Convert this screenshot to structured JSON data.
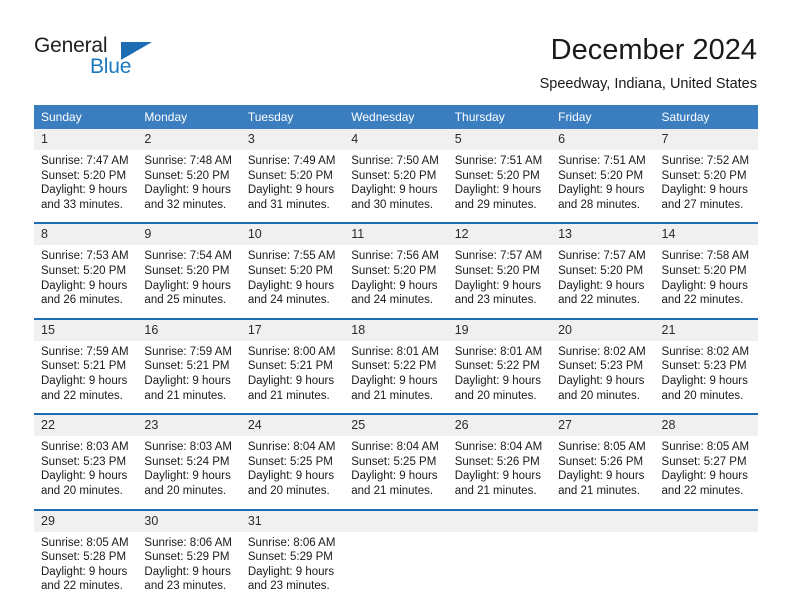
{
  "brand": {
    "name_part1": "General",
    "name_part2": "Blue",
    "logo_icon": "triangle-flag-icon",
    "accent_color": "#1c6cb3"
  },
  "header": {
    "title": "December 2024",
    "subtitle": "Speedway, Indiana, United States"
  },
  "theme": {
    "header_blue": "#3a7ebf",
    "separator_blue": "#1c6cb3",
    "daynum_band": "#f0f0f0"
  },
  "weekday_headers": [
    "Sunday",
    "Monday",
    "Tuesday",
    "Wednesday",
    "Thursday",
    "Friday",
    "Saturday"
  ],
  "weeks": [
    [
      {
        "day": "1",
        "sunrise": "Sunrise: 7:47 AM",
        "sunset": "Sunset: 5:20 PM",
        "daylight_1": "Daylight: 9 hours",
        "daylight_2": "and 33 minutes."
      },
      {
        "day": "2",
        "sunrise": "Sunrise: 7:48 AM",
        "sunset": "Sunset: 5:20 PM",
        "daylight_1": "Daylight: 9 hours",
        "daylight_2": "and 32 minutes."
      },
      {
        "day": "3",
        "sunrise": "Sunrise: 7:49 AM",
        "sunset": "Sunset: 5:20 PM",
        "daylight_1": "Daylight: 9 hours",
        "daylight_2": "and 31 minutes."
      },
      {
        "day": "4",
        "sunrise": "Sunrise: 7:50 AM",
        "sunset": "Sunset: 5:20 PM",
        "daylight_1": "Daylight: 9 hours",
        "daylight_2": "and 30 minutes."
      },
      {
        "day": "5",
        "sunrise": "Sunrise: 7:51 AM",
        "sunset": "Sunset: 5:20 PM",
        "daylight_1": "Daylight: 9 hours",
        "daylight_2": "and 29 minutes."
      },
      {
        "day": "6",
        "sunrise": "Sunrise: 7:51 AM",
        "sunset": "Sunset: 5:20 PM",
        "daylight_1": "Daylight: 9 hours",
        "daylight_2": "and 28 minutes."
      },
      {
        "day": "7",
        "sunrise": "Sunrise: 7:52 AM",
        "sunset": "Sunset: 5:20 PM",
        "daylight_1": "Daylight: 9 hours",
        "daylight_2": "and 27 minutes."
      }
    ],
    [
      {
        "day": "8",
        "sunrise": "Sunrise: 7:53 AM",
        "sunset": "Sunset: 5:20 PM",
        "daylight_1": "Daylight: 9 hours",
        "daylight_2": "and 26 minutes."
      },
      {
        "day": "9",
        "sunrise": "Sunrise: 7:54 AM",
        "sunset": "Sunset: 5:20 PM",
        "daylight_1": "Daylight: 9 hours",
        "daylight_2": "and 25 minutes."
      },
      {
        "day": "10",
        "sunrise": "Sunrise: 7:55 AM",
        "sunset": "Sunset: 5:20 PM",
        "daylight_1": "Daylight: 9 hours",
        "daylight_2": "and 24 minutes."
      },
      {
        "day": "11",
        "sunrise": "Sunrise: 7:56 AM",
        "sunset": "Sunset: 5:20 PM",
        "daylight_1": "Daylight: 9 hours",
        "daylight_2": "and 24 minutes."
      },
      {
        "day": "12",
        "sunrise": "Sunrise: 7:57 AM",
        "sunset": "Sunset: 5:20 PM",
        "daylight_1": "Daylight: 9 hours",
        "daylight_2": "and 23 minutes."
      },
      {
        "day": "13",
        "sunrise": "Sunrise: 7:57 AM",
        "sunset": "Sunset: 5:20 PM",
        "daylight_1": "Daylight: 9 hours",
        "daylight_2": "and 22 minutes."
      },
      {
        "day": "14",
        "sunrise": "Sunrise: 7:58 AM",
        "sunset": "Sunset: 5:20 PM",
        "daylight_1": "Daylight: 9 hours",
        "daylight_2": "and 22 minutes."
      }
    ],
    [
      {
        "day": "15",
        "sunrise": "Sunrise: 7:59 AM",
        "sunset": "Sunset: 5:21 PM",
        "daylight_1": "Daylight: 9 hours",
        "daylight_2": "and 22 minutes."
      },
      {
        "day": "16",
        "sunrise": "Sunrise: 7:59 AM",
        "sunset": "Sunset: 5:21 PM",
        "daylight_1": "Daylight: 9 hours",
        "daylight_2": "and 21 minutes."
      },
      {
        "day": "17",
        "sunrise": "Sunrise: 8:00 AM",
        "sunset": "Sunset: 5:21 PM",
        "daylight_1": "Daylight: 9 hours",
        "daylight_2": "and 21 minutes."
      },
      {
        "day": "18",
        "sunrise": "Sunrise: 8:01 AM",
        "sunset": "Sunset: 5:22 PM",
        "daylight_1": "Daylight: 9 hours",
        "daylight_2": "and 21 minutes."
      },
      {
        "day": "19",
        "sunrise": "Sunrise: 8:01 AM",
        "sunset": "Sunset: 5:22 PM",
        "daylight_1": "Daylight: 9 hours",
        "daylight_2": "and 20 minutes."
      },
      {
        "day": "20",
        "sunrise": "Sunrise: 8:02 AM",
        "sunset": "Sunset: 5:23 PM",
        "daylight_1": "Daylight: 9 hours",
        "daylight_2": "and 20 minutes."
      },
      {
        "day": "21",
        "sunrise": "Sunrise: 8:02 AM",
        "sunset": "Sunset: 5:23 PM",
        "daylight_1": "Daylight: 9 hours",
        "daylight_2": "and 20 minutes."
      }
    ],
    [
      {
        "day": "22",
        "sunrise": "Sunrise: 8:03 AM",
        "sunset": "Sunset: 5:23 PM",
        "daylight_1": "Daylight: 9 hours",
        "daylight_2": "and 20 minutes."
      },
      {
        "day": "23",
        "sunrise": "Sunrise: 8:03 AM",
        "sunset": "Sunset: 5:24 PM",
        "daylight_1": "Daylight: 9 hours",
        "daylight_2": "and 20 minutes."
      },
      {
        "day": "24",
        "sunrise": "Sunrise: 8:04 AM",
        "sunset": "Sunset: 5:25 PM",
        "daylight_1": "Daylight: 9 hours",
        "daylight_2": "and 20 minutes."
      },
      {
        "day": "25",
        "sunrise": "Sunrise: 8:04 AM",
        "sunset": "Sunset: 5:25 PM",
        "daylight_1": "Daylight: 9 hours",
        "daylight_2": "and 21 minutes."
      },
      {
        "day": "26",
        "sunrise": "Sunrise: 8:04 AM",
        "sunset": "Sunset: 5:26 PM",
        "daylight_1": "Daylight: 9 hours",
        "daylight_2": "and 21 minutes."
      },
      {
        "day": "27",
        "sunrise": "Sunrise: 8:05 AM",
        "sunset": "Sunset: 5:26 PM",
        "daylight_1": "Daylight: 9 hours",
        "daylight_2": "and 21 minutes."
      },
      {
        "day": "28",
        "sunrise": "Sunrise: 8:05 AM",
        "sunset": "Sunset: 5:27 PM",
        "daylight_1": "Daylight: 9 hours",
        "daylight_2": "and 22 minutes."
      }
    ],
    [
      {
        "day": "29",
        "sunrise": "Sunrise: 8:05 AM",
        "sunset": "Sunset: 5:28 PM",
        "daylight_1": "Daylight: 9 hours",
        "daylight_2": "and 22 minutes."
      },
      {
        "day": "30",
        "sunrise": "Sunrise: 8:06 AM",
        "sunset": "Sunset: 5:29 PM",
        "daylight_1": "Daylight: 9 hours",
        "daylight_2": "and 23 minutes."
      },
      {
        "day": "31",
        "sunrise": "Sunrise: 8:06 AM",
        "sunset": "Sunset: 5:29 PM",
        "daylight_1": "Daylight: 9 hours",
        "daylight_2": "and 23 minutes."
      },
      {
        "day": "",
        "sunrise": "",
        "sunset": "",
        "daylight_1": "",
        "daylight_2": ""
      },
      {
        "day": "",
        "sunrise": "",
        "sunset": "",
        "daylight_1": "",
        "daylight_2": ""
      },
      {
        "day": "",
        "sunrise": "",
        "sunset": "",
        "daylight_1": "",
        "daylight_2": ""
      },
      {
        "day": "",
        "sunrise": "",
        "sunset": "",
        "daylight_1": "",
        "daylight_2": ""
      }
    ]
  ]
}
